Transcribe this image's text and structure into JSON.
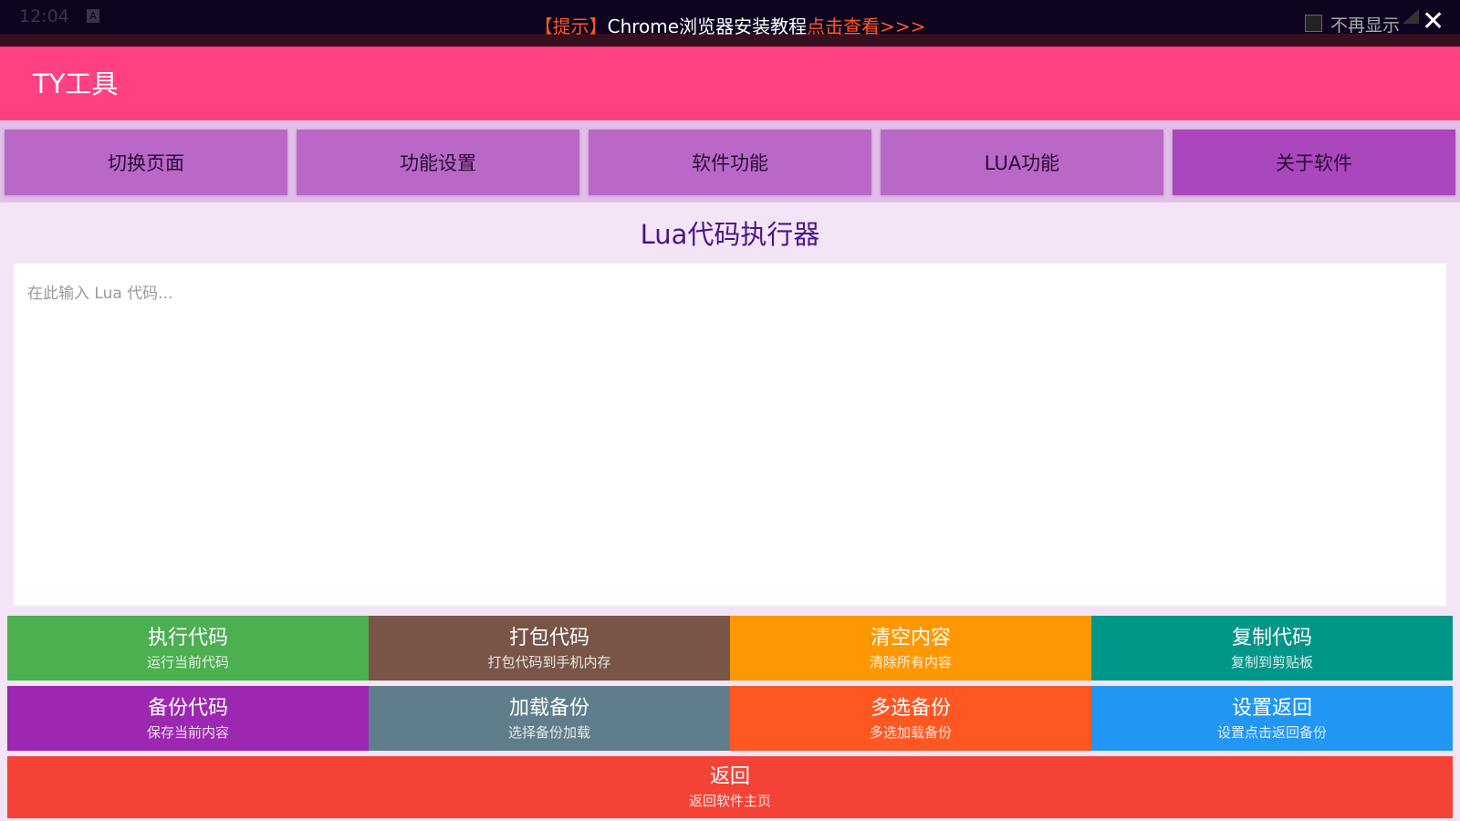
{
  "status_bar": {
    "time": "12:04",
    "keyboard_icon": "A"
  },
  "notice": {
    "prefix": "【提示】",
    "text": "Chrome浏览器安装教程",
    "link": "点击查看>>>",
    "dont_show": "不再显示",
    "close_icon": "close-icon"
  },
  "header": {
    "title": "TY工具"
  },
  "tabs": [
    {
      "label": "切换页面"
    },
    {
      "label": "功能设置"
    },
    {
      "label": "软件功能"
    },
    {
      "label": "LUA功能"
    },
    {
      "label": "关于软件",
      "active": true
    }
  ],
  "main": {
    "title": "Lua代码执行器",
    "editor": {
      "value": "",
      "placeholder": "在此输入 Lua 代码..."
    }
  },
  "buttons": [
    {
      "label": "执行代码",
      "sub": "运行当前代码",
      "color": "#4caf50"
    },
    {
      "label": "打包代码",
      "sub": "打包代码到手机内存",
      "color": "#795548"
    },
    {
      "label": "清空内容",
      "sub": "清除所有内容",
      "color": "#ff9800"
    },
    {
      "label": "复制代码",
      "sub": "复制到剪贴板",
      "color": "#009688"
    },
    {
      "label": "备份代码",
      "sub": "保存当前内容",
      "color": "#9c27b0"
    },
    {
      "label": "加载备份",
      "sub": "选择备份加载",
      "color": "#607d8b"
    },
    {
      "label": "多选备份",
      "sub": "多选加载备份",
      "color": "#ff5722"
    },
    {
      "label": "设置返回",
      "sub": "设置点击返回备份",
      "color": "#2196f3"
    },
    {
      "label": "返回",
      "sub": "返回软件主页",
      "color": "#f44336"
    }
  ]
}
